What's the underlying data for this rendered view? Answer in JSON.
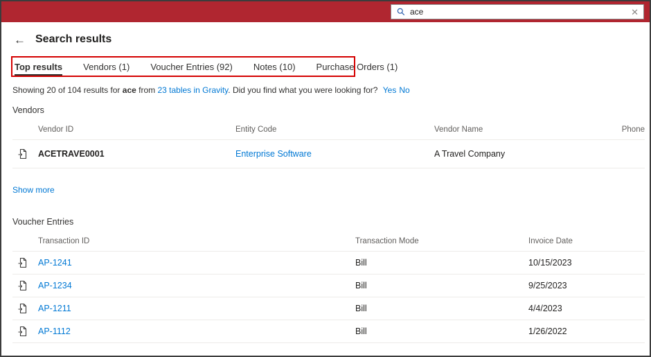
{
  "colors": {
    "header_red": "#b02630",
    "annotation_red": "#d40000",
    "link_blue": "#0078d4",
    "text_dark": "#201f1e",
    "text_muted": "#605e5c",
    "divider": "#edebe9",
    "active_tab_underline": "#323130"
  },
  "header": {
    "search": {
      "value": "ace",
      "clear_glyph": "✕"
    }
  },
  "page": {
    "back_glyph": "←",
    "title": "Search results"
  },
  "tabs": [
    {
      "label": "Top results"
    },
    {
      "label": "Vendors (1)"
    },
    {
      "label": "Voucher Entries (92)"
    },
    {
      "label": "Notes (10)"
    },
    {
      "label": "Purchase Orders (1)"
    }
  ],
  "summary": {
    "prefix": "Showing 20 of 104 results for ",
    "term": "ace",
    "mid1": " from ",
    "tables_link": "23 tables in Gravity",
    "mid2": ". Did you find what you were looking for? ",
    "yes": "Yes",
    "no": "No"
  },
  "vendors": {
    "section_title": "Vendors",
    "columns": [
      "Vendor ID",
      "Entity Code",
      "Vendor Name",
      "Phone"
    ],
    "rows": [
      {
        "vendor_id": "ACETRAVE0001",
        "entity_code": "Enterprise Software",
        "vendor_name": "A Travel Company",
        "phone": ""
      }
    ],
    "show_more": "Show more"
  },
  "vouchers": {
    "section_title": "Voucher Entries",
    "columns": [
      "Transaction ID",
      "Transaction Mode",
      "Invoice Date"
    ],
    "rows": [
      {
        "transaction_id": "AP-1241",
        "mode": "Bill",
        "invoice_date": "10/15/2023"
      },
      {
        "transaction_id": "AP-1234",
        "mode": "Bill",
        "invoice_date": "9/25/2023"
      },
      {
        "transaction_id": "AP-1211",
        "mode": "Bill",
        "invoice_date": "4/4/2023"
      },
      {
        "transaction_id": "AP-1112",
        "mode": "Bill",
        "invoice_date": "1/26/2022"
      }
    ]
  }
}
